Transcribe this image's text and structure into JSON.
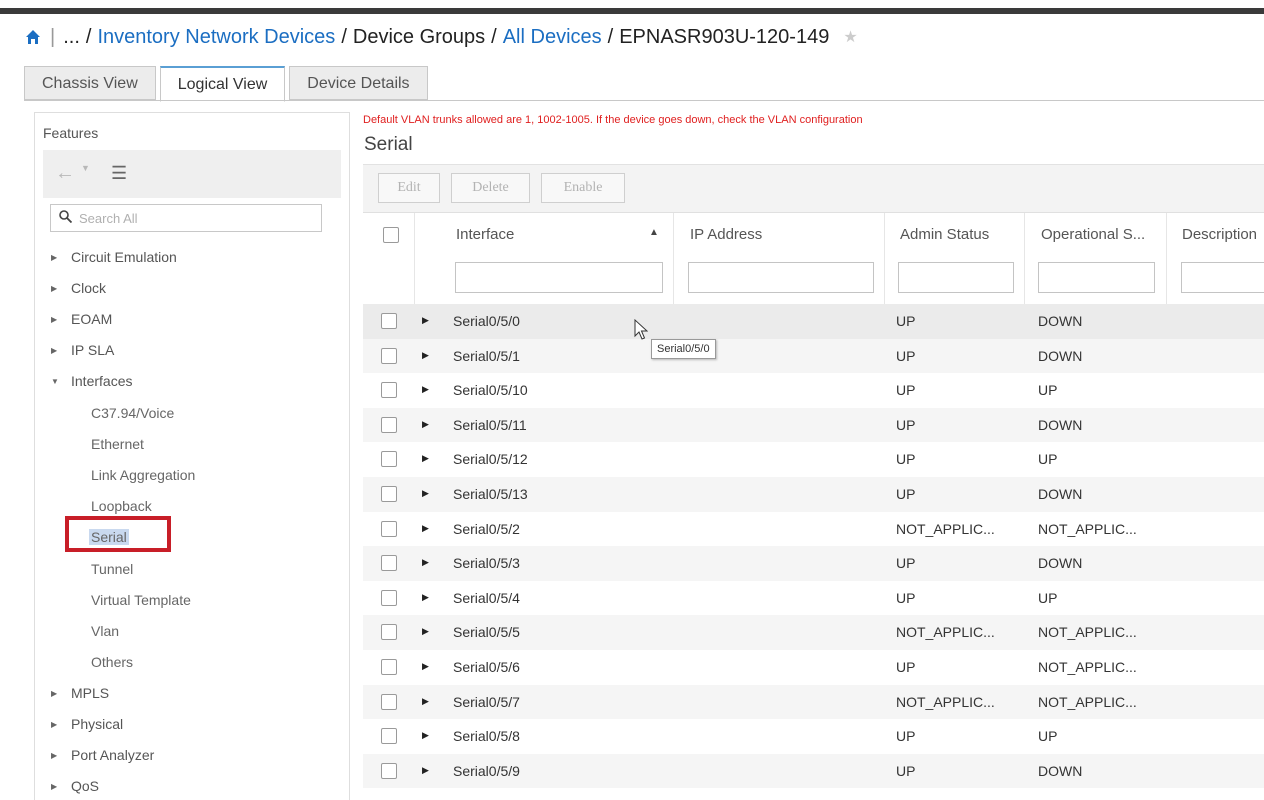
{
  "breadcrumb": {
    "ellipsis": "...",
    "items": [
      {
        "label": "Inventory Network Devices",
        "link": true
      },
      {
        "label": "Device Groups",
        "link": false
      },
      {
        "label": "All Devices",
        "link": true
      },
      {
        "label": "EPNASR903U-120-149",
        "link": false
      }
    ],
    "separator": "/",
    "pipe": "|",
    "star": "★"
  },
  "tabs": [
    {
      "label": "Chassis View",
      "active": false
    },
    {
      "label": "Logical View",
      "active": true
    },
    {
      "label": "Device Details",
      "active": false
    }
  ],
  "features": {
    "title": "Features",
    "search_placeholder": "Search All",
    "tree": [
      {
        "label": "Circuit Emulation",
        "level": 0,
        "expanded": false
      },
      {
        "label": "Clock",
        "level": 0,
        "expanded": false
      },
      {
        "label": "EOAM",
        "level": 0,
        "expanded": false
      },
      {
        "label": "IP SLA",
        "level": 0,
        "expanded": false
      },
      {
        "label": "Interfaces",
        "level": 0,
        "expanded": true
      },
      {
        "label": "C37.94/Voice",
        "level": 1
      },
      {
        "label": "Ethernet",
        "level": 1
      },
      {
        "label": "Link Aggregation",
        "level": 1
      },
      {
        "label": "Loopback",
        "level": 1
      },
      {
        "label": "Serial",
        "level": 1,
        "selected": true
      },
      {
        "label": "Tunnel",
        "level": 1
      },
      {
        "label": "Virtual Template",
        "level": 1
      },
      {
        "label": "Vlan",
        "level": 1
      },
      {
        "label": "Others",
        "level": 1
      },
      {
        "label": "MPLS",
        "level": 0,
        "expanded": false
      },
      {
        "label": "Physical",
        "level": 0,
        "expanded": false
      },
      {
        "label": "Port Analyzer",
        "level": 0,
        "expanded": false
      },
      {
        "label": "QoS",
        "level": 0,
        "expanded": false
      }
    ]
  },
  "content": {
    "vlan_message": "Default VLAN trunks allowed are 1, 1002-1005. If the device goes down, check the VLAN configuration",
    "section_title": "Serial",
    "actions": {
      "edit": "Edit",
      "delete": "Delete",
      "enable": "Enable"
    },
    "columns": {
      "interface": "Interface",
      "ip_address": "IP Address",
      "admin_status": "Admin Status",
      "operational_status": "Operational S...",
      "description": "Description"
    },
    "rows": [
      {
        "interface": "Serial0/5/0",
        "ip": "",
        "admin": "UP",
        "oper": "DOWN"
      },
      {
        "interface": "Serial0/5/1",
        "ip": "",
        "admin": "UP",
        "oper": "DOWN"
      },
      {
        "interface": "Serial0/5/10",
        "ip": "",
        "admin": "UP",
        "oper": "UP"
      },
      {
        "interface": "Serial0/5/11",
        "ip": "",
        "admin": "UP",
        "oper": "DOWN"
      },
      {
        "interface": "Serial0/5/12",
        "ip": "",
        "admin": "UP",
        "oper": "UP"
      },
      {
        "interface": "Serial0/5/13",
        "ip": "",
        "admin": "UP",
        "oper": "DOWN"
      },
      {
        "interface": "Serial0/5/2",
        "ip": "",
        "admin": "NOT_APPLIC...",
        "oper": "NOT_APPLIC..."
      },
      {
        "interface": "Serial0/5/3",
        "ip": "",
        "admin": "UP",
        "oper": "DOWN"
      },
      {
        "interface": "Serial0/5/4",
        "ip": "",
        "admin": "UP",
        "oper": "UP"
      },
      {
        "interface": "Serial0/5/5",
        "ip": "",
        "admin": "NOT_APPLIC...",
        "oper": "NOT_APPLIC..."
      },
      {
        "interface": "Serial0/5/6",
        "ip": "",
        "admin": "UP",
        "oper": "NOT_APPLIC..."
      },
      {
        "interface": "Serial0/5/7",
        "ip": "",
        "admin": "NOT_APPLIC...",
        "oper": "NOT_APPLIC..."
      },
      {
        "interface": "Serial0/5/8",
        "ip": "",
        "admin": "UP",
        "oper": "UP"
      },
      {
        "interface": "Serial0/5/9",
        "ip": "",
        "admin": "UP",
        "oper": "DOWN"
      }
    ],
    "tooltip": "Serial0/5/0"
  },
  "colors": {
    "link": "#1b6ec2",
    "warning_text": "#e02020",
    "selection_box": "#c81e28"
  },
  "icons": {
    "home": "home-icon",
    "star": "star-icon",
    "back": "back-arrow-icon",
    "list": "list-icon",
    "search": "search-icon",
    "sort": "sort-ascending-icon",
    "expand": "expand-arrow-icon",
    "cursor": "mouse-cursor-icon"
  }
}
